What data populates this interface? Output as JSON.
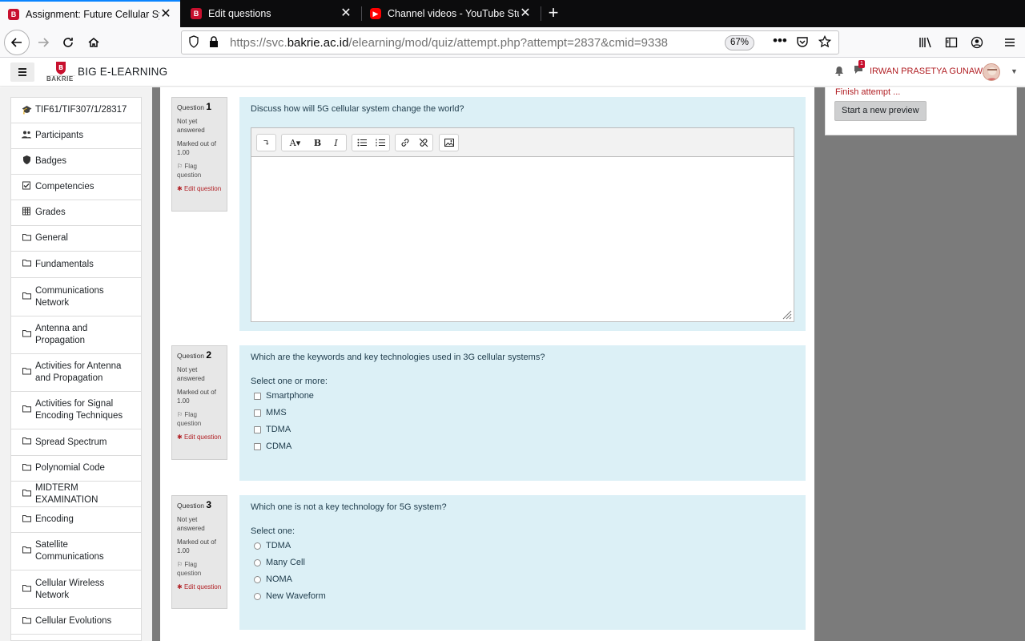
{
  "browser": {
    "tabs": [
      {
        "title": "Assignment: Future Cellular Sy",
        "favicon": "bakrie-favicon",
        "active": true
      },
      {
        "title": "Edit questions",
        "favicon": "bakrie-favicon",
        "active": false
      },
      {
        "title": "Channel videos - YouTube Stu",
        "favicon": "youtube-favicon",
        "active": false
      }
    ],
    "url_prefix": "https://svc.",
    "url_domain": "bakrie.ac.id",
    "url_path": "/elearning/mod/quiz/attempt.php?attempt=2837&cmid=9338",
    "zoom": "67%"
  },
  "header": {
    "site_name": "BIG E-LEARNING",
    "user_name": "IRWAN PRASETYA GUNAWAN",
    "logo_text": "BAKRIE",
    "msg_badge": "1"
  },
  "sidebar": {
    "items": [
      {
        "label": "TIF61/TIF307/1/28317",
        "icon": "graduation-cap-icon"
      },
      {
        "label": "Participants",
        "icon": "users-icon"
      },
      {
        "label": "Badges",
        "icon": "shield-icon"
      },
      {
        "label": "Competencies",
        "icon": "check-square-icon"
      },
      {
        "label": "Grades",
        "icon": "table-icon"
      },
      {
        "label": "General",
        "icon": "folder-icon"
      },
      {
        "label": "Fundamentals",
        "icon": "folder-icon"
      },
      {
        "label": "Communications Network",
        "icon": "folder-icon"
      },
      {
        "label": "Antenna and Propagation",
        "icon": "folder-icon"
      },
      {
        "label": "Activities for Antenna and Propagation",
        "icon": "folder-icon"
      },
      {
        "label": "Activities for Signal Encoding Techniques",
        "icon": "folder-icon"
      },
      {
        "label": "Spread Spectrum",
        "icon": "folder-icon"
      },
      {
        "label": "Polynomial Code",
        "icon": "folder-icon"
      },
      {
        "label": "MIDTERM EXAMINATION",
        "icon": "folder-icon"
      },
      {
        "label": "Encoding",
        "icon": "folder-icon"
      },
      {
        "label": "Satellite Communications",
        "icon": "folder-icon"
      },
      {
        "label": "Cellular Wireless Network",
        "icon": "folder-icon"
      },
      {
        "label": "Cellular Evolutions",
        "icon": "folder-icon"
      }
    ]
  },
  "quiz_nav": {
    "finish_label": "Finish attempt ...",
    "new_preview_label": "Start a new preview"
  },
  "questions": [
    {
      "label": "Question",
      "number": "1",
      "state": "Not yet answered",
      "marked": "Marked out of 1.00",
      "flag": "Flag question",
      "edit": "Edit question",
      "text": "Discuss how will 5G cellular system change the world?"
    },
    {
      "label": "Question",
      "number": "2",
      "state": "Not yet answered",
      "marked": "Marked out of 1.00",
      "flag": "Flag question",
      "edit": "Edit question",
      "text": "Which are the keywords and key technologies used in 3G cellular systems?",
      "prompt": "Select one or more:",
      "options": [
        "Smartphone",
        "MMS",
        "TDMA",
        "CDMA"
      ]
    },
    {
      "label": "Question",
      "number": "3",
      "state": "Not yet answered",
      "marked": "Marked out of 1.00",
      "flag": "Flag question",
      "edit": "Edit question",
      "text": "Which one is not a key technology for 5G system?",
      "prompt": "Select one:",
      "options": [
        "TDMA",
        "Many Cell",
        "NOMA",
        "New Waveform"
      ]
    }
  ],
  "colors": {
    "brand_red": "#b11f24",
    "question_bg": "#dcf0f6",
    "info_bg": "#e7e7e7",
    "tab_accent": "#0a84ff"
  }
}
